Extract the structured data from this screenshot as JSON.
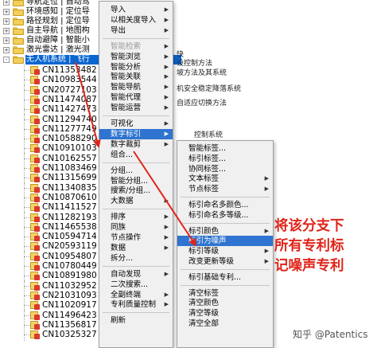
{
  "tree": {
    "folders": [
      {
        "label": "导航定位 | 自动驾",
        "expander": "+"
      },
      {
        "label": "环境感知 | 定位导",
        "expander": "+"
      },
      {
        "label": "路径规划 | 定位导",
        "expander": "+"
      },
      {
        "label": "自主导航 | 地图构",
        "expander": "+"
      },
      {
        "label": "自动避障 | 智能小",
        "expander": "+"
      },
      {
        "label": "激光雷达 | 激光测",
        "expander": "+"
      },
      {
        "label": "无人机系统 | 飞行",
        "expander": "-",
        "selected": true
      }
    ],
    "patents": [
      "CN11353482",
      "CN10983544",
      "CN20727103",
      "CN11474087",
      "CN11427473",
      "CN11294740",
      "CN11277749",
      "CN10588290",
      "CN10910103",
      "CN10162557",
      "CN11083469",
      "CN11315699",
      "CN11340835",
      "CN10870610",
      "CN11411527",
      "CN11282193",
      "CN11465538",
      "CN10594714",
      "CN20593119",
      "CN10954807",
      "CN10780449",
      "CN10891980",
      "CN11032952",
      "CN21031093",
      "CN11020917",
      "CN11496423",
      "CN11356817",
      "CN10325327"
    ],
    "background_texts": [
      "快",
      "设控制方法",
      "坡方法及其系统",
      "机安全稳定降落系统",
      "自适应切换方法",
      "控制系统"
    ]
  },
  "context_menu": {
    "items": [
      {
        "label": "导入",
        "arrow": true
      },
      {
        "label": "以相关度导入",
        "arrow": true
      },
      {
        "label": "导出",
        "arrow": true
      },
      {
        "sep": true
      },
      {
        "label": "智能检索",
        "arrow": true,
        "disabled": true
      },
      {
        "label": "智能浏览",
        "arrow": true
      },
      {
        "label": "智能分析",
        "arrow": true
      },
      {
        "label": "智能关联",
        "arrow": true
      },
      {
        "label": "智能导航",
        "arrow": true
      },
      {
        "label": "智能代理",
        "arrow": true
      },
      {
        "label": "智能运营",
        "arrow": true
      },
      {
        "sep": true
      },
      {
        "label": "可视化",
        "arrow": true
      },
      {
        "label": "数字标引",
        "arrow": true,
        "highlight": true
      },
      {
        "label": "数字裁剪",
        "arrow": true
      },
      {
        "label": "组合...",
        "arrow": false
      },
      {
        "sep": true
      },
      {
        "label": "分组...",
        "arrow": false
      },
      {
        "label": "智能分组...",
        "arrow": false
      },
      {
        "label": "搜索/分组...",
        "arrow": false
      },
      {
        "label": "大数据",
        "arrow": true
      },
      {
        "sep": true
      },
      {
        "label": "排序",
        "arrow": true
      },
      {
        "label": "同族",
        "arrow": true
      },
      {
        "label": "节点操作",
        "arrow": true
      },
      {
        "label": "数据",
        "arrow": true
      },
      {
        "label": "拆分...",
        "arrow": false
      },
      {
        "sep": true
      },
      {
        "label": "自动发现",
        "arrow": true
      },
      {
        "label": "二次搜索...",
        "arrow": false
      },
      {
        "label": "全副终端",
        "arrow": true
      },
      {
        "label": "专利质量控制",
        "arrow": true
      },
      {
        "sep": true
      },
      {
        "label": "刷新",
        "arrow": false
      }
    ]
  },
  "submenu": {
    "items": [
      {
        "label": "智能标签..."
      },
      {
        "label": "标引标签..."
      },
      {
        "label": "协同标签..."
      },
      {
        "label": "文本标签",
        "arrow": true
      },
      {
        "label": "节点标签",
        "arrow": true
      },
      {
        "sep": true
      },
      {
        "label": "标引命名多颜色..."
      },
      {
        "label": "标引命名多等级..."
      },
      {
        "sep": true
      },
      {
        "label": "标引颜色",
        "arrow": true
      },
      {
        "label": "标引为噪声",
        "highlight": true
      },
      {
        "label": "标引等级",
        "arrow": true
      },
      {
        "label": "改变更新等级",
        "arrow": true
      },
      {
        "sep": true
      },
      {
        "label": "标引基础专利..."
      },
      {
        "sep": true
      },
      {
        "label": "清空标签"
      },
      {
        "label": "清空颜色"
      },
      {
        "label": "清空等级"
      },
      {
        "label": "清空全部"
      }
    ]
  },
  "annotation": {
    "lines": [
      "将该分支下",
      "所有专利标",
      "记噪声专利"
    ],
    "color": "#e0241a"
  },
  "watermark": "知乎 @Patentics",
  "colors": {
    "selection": "#0a66d0",
    "menu_highlight": "#2f74d0",
    "arrow": "#e0241a"
  }
}
